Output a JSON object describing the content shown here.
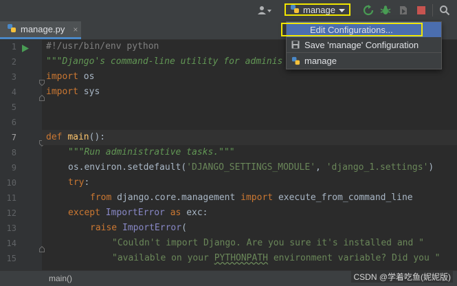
{
  "toolbar": {
    "run_config_label": "manage",
    "icons": [
      "user-icon",
      "run-config-python-icon",
      "rerun-icon",
      "debug-icon",
      "coverage-icon",
      "stop-icon",
      "search-icon"
    ],
    "colors": {
      "highlight": "#f2e600",
      "run": "#499c54",
      "stop": "#c75450"
    }
  },
  "tab": {
    "filename": "manage.py",
    "close": "×"
  },
  "dropdown": {
    "items": [
      {
        "label": "Edit Configurations...",
        "selected": true
      },
      {
        "label": "Save 'manage' Configuration",
        "icon": "save-icon"
      },
      {
        "label": "manage",
        "icon": "python-icon"
      }
    ]
  },
  "code": {
    "line_numbers": [
      "1",
      "2",
      "3",
      "4",
      "5",
      "6",
      "7",
      "8",
      "9",
      "10",
      "11",
      "12",
      "13",
      "14",
      "15"
    ],
    "current_line": "7",
    "l1": "#!/usr/bin/env python",
    "l2": "\"\"\"Django's command-line utility for adminis",
    "l3_kw": "import",
    "l3_rest": " os",
    "l4_kw": "import",
    "l4_rest": " sys",
    "l7_kw": "def",
    "l7_fn": "main",
    "l7_rest": "():",
    "l8": "\"\"\"Run administrative tasks.\"\"\"",
    "l9_a": "os.environ.setdefault(",
    "l9_s1": "'DJANGO_SETTINGS_MODULE'",
    "l9_b": ", ",
    "l9_s2": "'django_1.settings'",
    "l9_c": ")",
    "l10_kw": "try",
    "l10_rest": ":",
    "l11_kw1": "from",
    "l11_a": " django.core.management ",
    "l11_kw2": "import",
    "l11_b": " execute_from_command_line",
    "l12_kw1": "except",
    "l12_bi": " ImportError",
    "l12_kw2": " as",
    "l12_rest": " exc:",
    "l13_kw": "raise",
    "l13_bi": " ImportError",
    "l13_rest": "(",
    "l14": "\"Couldn't import Django. Are you sure it's installed and \"",
    "l15_a": "\"available on your ",
    "l15_sq": "PYTHONPATH",
    "l15_b": " environment variable? Did you \""
  },
  "status": {
    "breadcrumb": "main()",
    "watermark": "CSDN @学着吃鱼(妮妮版)"
  }
}
